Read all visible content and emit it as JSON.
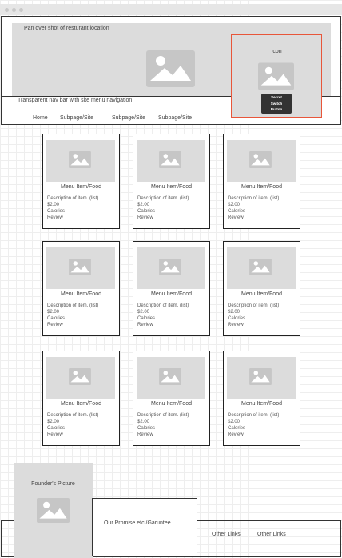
{
  "header": {
    "hero_caption": "Pan over shot of resturant location",
    "nav_caption": "Transparent nav bar with site menu navigation",
    "nav_items": [
      "Home",
      "Subpage/Site",
      "Subpage/Site",
      "Subpage/Site"
    ],
    "icon_panel": {
      "label": "Icon",
      "button_line1": "Secret",
      "button_line2": "Switch",
      "button_line3": "Button",
      "accent_color": "#e8563a"
    }
  },
  "menu": {
    "cards": [
      {
        "title": "Menu Item/Food",
        "desc": "Description of item. (list)",
        "price": "$2.00",
        "calories": "Calories",
        "review": "Review"
      },
      {
        "title": "Menu Item/Food",
        "desc": "Description of item. (list)",
        "price": "$2.00",
        "calories": "Calories",
        "review": "Review"
      },
      {
        "title": "Menu Item/Food",
        "desc": "Description of item. (list)",
        "price": "$2.00",
        "calories": "Calories",
        "review": "Review"
      },
      {
        "title": "Menu Item/Food",
        "desc": "Description of item. (list)",
        "price": "$2.00",
        "calories": "Calories",
        "review": "Review"
      },
      {
        "title": "Menu Item/Food",
        "desc": "Description of item. (list)",
        "price": "$2.00",
        "calories": "Calories",
        "review": "Review"
      },
      {
        "title": "Menu Item/Food",
        "desc": "Description of item. (list)",
        "price": "$2.00",
        "calories": "Calories",
        "review": "Review"
      },
      {
        "title": "Menu Item/Food",
        "desc": "Description of item. (list)",
        "price": "$2.00",
        "calories": "Calories",
        "review": "Review"
      },
      {
        "title": "Menu Item/Food",
        "desc": "Description of item. (list)",
        "price": "$2.00",
        "calories": "Calories",
        "review": "Review"
      },
      {
        "title": "Menu Item/Food",
        "desc": "Description of item. (list)",
        "price": "$2.00",
        "calories": "Calories",
        "review": "Review"
      }
    ]
  },
  "footer": {
    "founder_caption": "Founder's Picture",
    "promise_caption": "Our Promise etc./Garuntee",
    "links": [
      "Other Links",
      "Other Links"
    ]
  }
}
